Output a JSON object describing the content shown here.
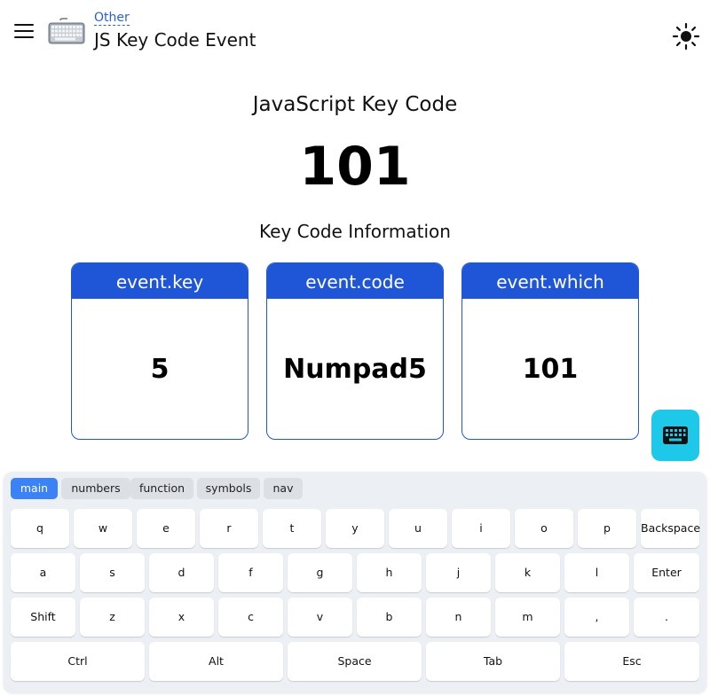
{
  "header": {
    "breadcrumb": "Other",
    "title": "JS Key Code Event",
    "icons": {
      "menu": "hamburger-menu-icon",
      "logo": "keyboard-icon",
      "theme": "sun-icon"
    }
  },
  "main": {
    "heading": "JavaScript Key Code",
    "key_code": "101",
    "info_heading": "Key Code Information",
    "cards": [
      {
        "label": "event.key",
        "value": "5"
      },
      {
        "label": "event.code",
        "value": "Numpad5"
      },
      {
        "label": "event.which",
        "value": "101"
      }
    ],
    "fab_icon": "keyboard-icon"
  },
  "keyboard": {
    "tabs": [
      "main",
      "numbers",
      "function",
      "symbols",
      "nav"
    ],
    "active_tab": "main",
    "rows": [
      [
        "q",
        "w",
        "e",
        "r",
        "t",
        "y",
        "u",
        "i",
        "o",
        "p",
        "Backspace"
      ],
      [
        "a",
        "s",
        "d",
        "f",
        "g",
        "h",
        "j",
        "k",
        "l",
        "Enter"
      ],
      [
        "Shift",
        "z",
        "x",
        "c",
        "v",
        "b",
        "n",
        "m",
        ",",
        "."
      ],
      [
        "Ctrl",
        "Alt",
        "Space",
        "Tab",
        "Esc"
      ]
    ]
  },
  "colors": {
    "accent": "#1f56d8",
    "fab": "#1ec8e8",
    "active_tab": "#3b82f6",
    "link": "#2a5fd6"
  }
}
